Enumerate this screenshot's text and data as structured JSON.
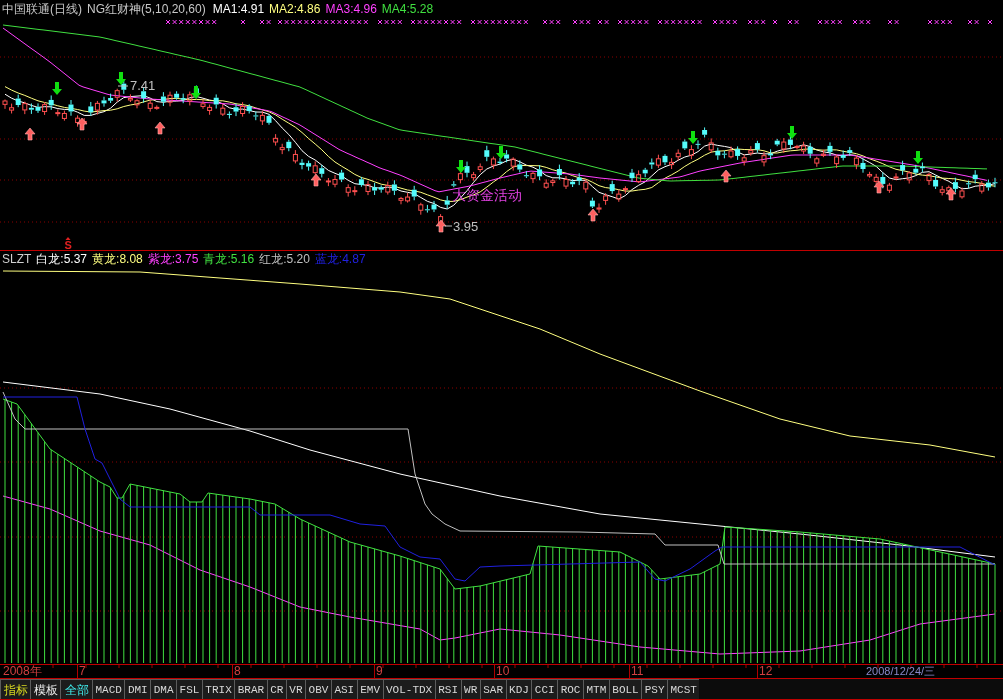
{
  "header": {
    "security": "中国联通(日线)",
    "indicator": "NG红财神(5,10,20,60)",
    "averages": [
      {
        "label": "MA1:4.91",
        "color": "#ffffff"
      },
      {
        "label": "MA2:4.86",
        "color": "#ffff80"
      },
      {
        "label": "MA3:4.96",
        "color": "#ff40ff"
      },
      {
        "label": "MA4:5.28",
        "color": "#40e040"
      }
    ]
  },
  "main_chart": {
    "high_label": "7.41",
    "low_label": "3.95",
    "note": "大资金活动",
    "signal_mark": "S"
  },
  "indicator_panel": {
    "name": "SLZT",
    "lines": [
      {
        "label": "白龙:5.37",
        "color": "#ffffff"
      },
      {
        "label": "黄龙:8.08",
        "color": "#ffff80"
      },
      {
        "label": "紫龙:3.75",
        "color": "#ff40ff"
      },
      {
        "label": "青龙:5.16",
        "color": "#40e040"
      },
      {
        "label": "红龙:5.20",
        "color": "#c0c0c0"
      },
      {
        "label": "蓝龙:4.87",
        "color": "#2020e0"
      }
    ]
  },
  "time_axis": {
    "year": "2008年",
    "months": [
      "7",
      "8",
      "9",
      "10",
      "11",
      "12"
    ],
    "cursor_date": "2008/12/24/三"
  },
  "tabs": [
    {
      "label": "指标",
      "kind": "mode",
      "selected": true
    },
    {
      "label": "模板",
      "kind": "mode",
      "selected": false
    },
    {
      "label": "全部",
      "kind": "group",
      "selected": true
    },
    {
      "label": "MACD",
      "kind": "indicator",
      "selected": false
    },
    {
      "label": "DMI",
      "kind": "indicator",
      "selected": false
    },
    {
      "label": "DMA",
      "kind": "indicator",
      "selected": false
    },
    {
      "label": "FSL",
      "kind": "indicator",
      "selected": false
    },
    {
      "label": "TRIX",
      "kind": "indicator",
      "selected": false
    },
    {
      "label": "BRAR",
      "kind": "indicator",
      "selected": false
    },
    {
      "label": "CR",
      "kind": "indicator",
      "selected": false
    },
    {
      "label": "VR",
      "kind": "indicator",
      "selected": false
    },
    {
      "label": "OBV",
      "kind": "indicator",
      "selected": false
    },
    {
      "label": "ASI",
      "kind": "indicator",
      "selected": false
    },
    {
      "label": "EMV",
      "kind": "indicator",
      "selected": false
    },
    {
      "label": "VOL-TDX",
      "kind": "indicator",
      "selected": false
    },
    {
      "label": "RSI",
      "kind": "indicator",
      "selected": false
    },
    {
      "label": "WR",
      "kind": "indicator",
      "selected": false
    },
    {
      "label": "SAR",
      "kind": "indicator",
      "selected": false
    },
    {
      "label": "KDJ",
      "kind": "indicator",
      "selected": false
    },
    {
      "label": "CCI",
      "kind": "indicator",
      "selected": false
    },
    {
      "label": "ROC",
      "kind": "indicator",
      "selected": false
    },
    {
      "label": "MTM",
      "kind": "indicator",
      "selected": false
    },
    {
      "label": "BOLL",
      "kind": "indicator",
      "selected": false
    },
    {
      "label": "PSY",
      "kind": "indicator",
      "selected": false
    },
    {
      "label": "MCST",
      "kind": "indicator",
      "selected": false
    }
  ]
}
